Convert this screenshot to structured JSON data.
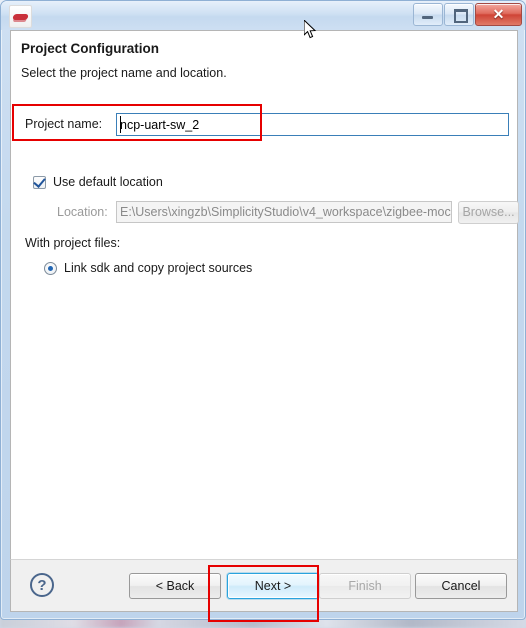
{
  "window": {
    "app_icon": "simplicity-studio-icon",
    "controls": {
      "minimize": "–",
      "maximize": "□",
      "close": "✕"
    }
  },
  "dialog": {
    "title": "Project Configuration",
    "subtitle": "Select the project name and location."
  },
  "form": {
    "project_name_label": "Project name:",
    "project_name_value": "ncp-uart-sw_2",
    "use_default_location_label": "Use default location",
    "use_default_location_checked": true,
    "location_label": "Location:",
    "location_value": "E:\\Users\\xingzb\\SimplicityStudio\\v4_workspace\\zigbee-moc",
    "browse_label": "Browse...",
    "section_label": "With project files:",
    "radio_label": "Link sdk and copy project sources",
    "radio_selected": true
  },
  "buttons": {
    "help": "?",
    "back": "< Back",
    "next": "Next >",
    "finish": "Finish",
    "cancel": "Cancel"
  },
  "annotations": {
    "project_name_highlight": "red-box-project-name",
    "next_highlight": "red-box-next-button"
  },
  "colors": {
    "annotation": "#e60000",
    "focus_border": "#2aa3dd",
    "field_border": "#3a7fb8",
    "close_button": "#cf4436"
  }
}
